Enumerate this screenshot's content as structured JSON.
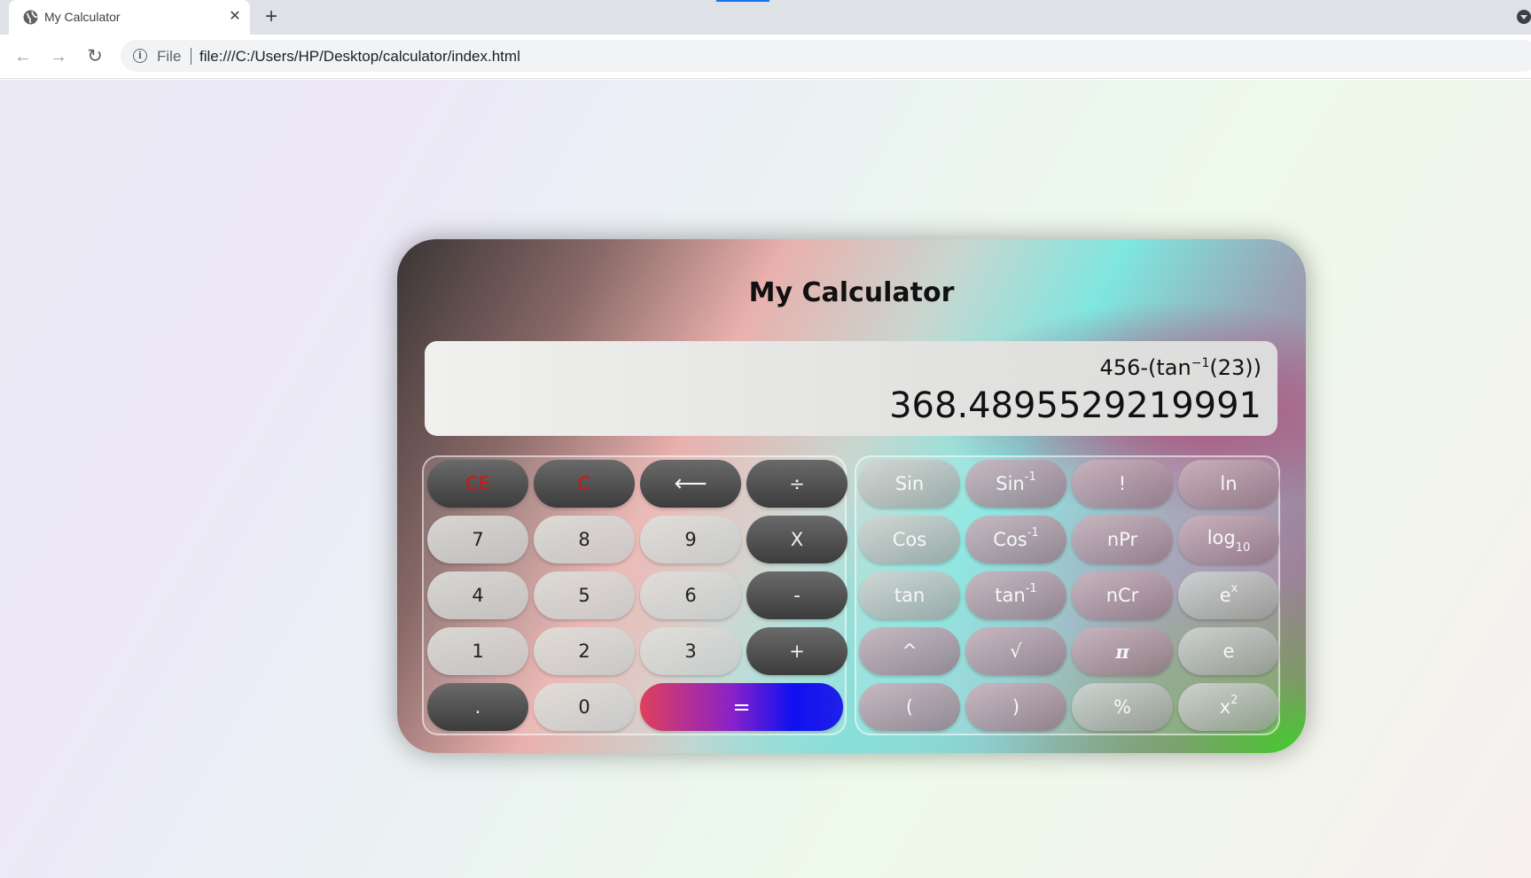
{
  "browser": {
    "tab_title": "My Calculator",
    "tab_close": "✕",
    "new_tab": "+",
    "back": "←",
    "forward": "→",
    "reload": "↻",
    "info_icon": "i",
    "scheme": "File",
    "url": "file:///C:/Users/HP/Desktop/calculator/index.html"
  },
  "calculator": {
    "title": "My Calculator",
    "expression_prefix": "456-(tan",
    "expression_sup": "−1",
    "expression_suffix": "(23))",
    "result": "368.4895529219991"
  },
  "basic_keys": {
    "ce": "CE",
    "c": "C",
    "backspace": "⟵",
    "divide": "÷",
    "k7": "7",
    "k8": "8",
    "k9": "9",
    "multiply": "X",
    "k4": "4",
    "k5": "5",
    "k6": "6",
    "minus": "-",
    "k1": "1",
    "k2": "2",
    "k3": "3",
    "plus": "+",
    "dot": ".",
    "k0": "0",
    "equals": "="
  },
  "sci_keys": {
    "sin": "Sin",
    "asin_base": "Sin",
    "asin_sup": "-1",
    "fact": "!",
    "ln": "ln",
    "cos": "Cos",
    "acos_base": "Cos",
    "acos_sup": "-1",
    "npr": "nPr",
    "log_base": "log",
    "log_sub": "10",
    "tan": "tan",
    "atan_base": "tan",
    "atan_sup": "-1",
    "ncr": "nCr",
    "exp_base": "e",
    "exp_sup": "x",
    "pow": "^",
    "sqrt": "√",
    "pi": "π",
    "e": "e",
    "lparen": "(",
    "rparen": ")",
    "percent": "%",
    "sq_base": "x",
    "sq_sup": "2"
  },
  "colors": {
    "clear_text": "#dd1010",
    "equals_gradient_start": "#e0405a",
    "equals_gradient_end": "#1010f0",
    "tab_accent": "#1a73e8"
  }
}
